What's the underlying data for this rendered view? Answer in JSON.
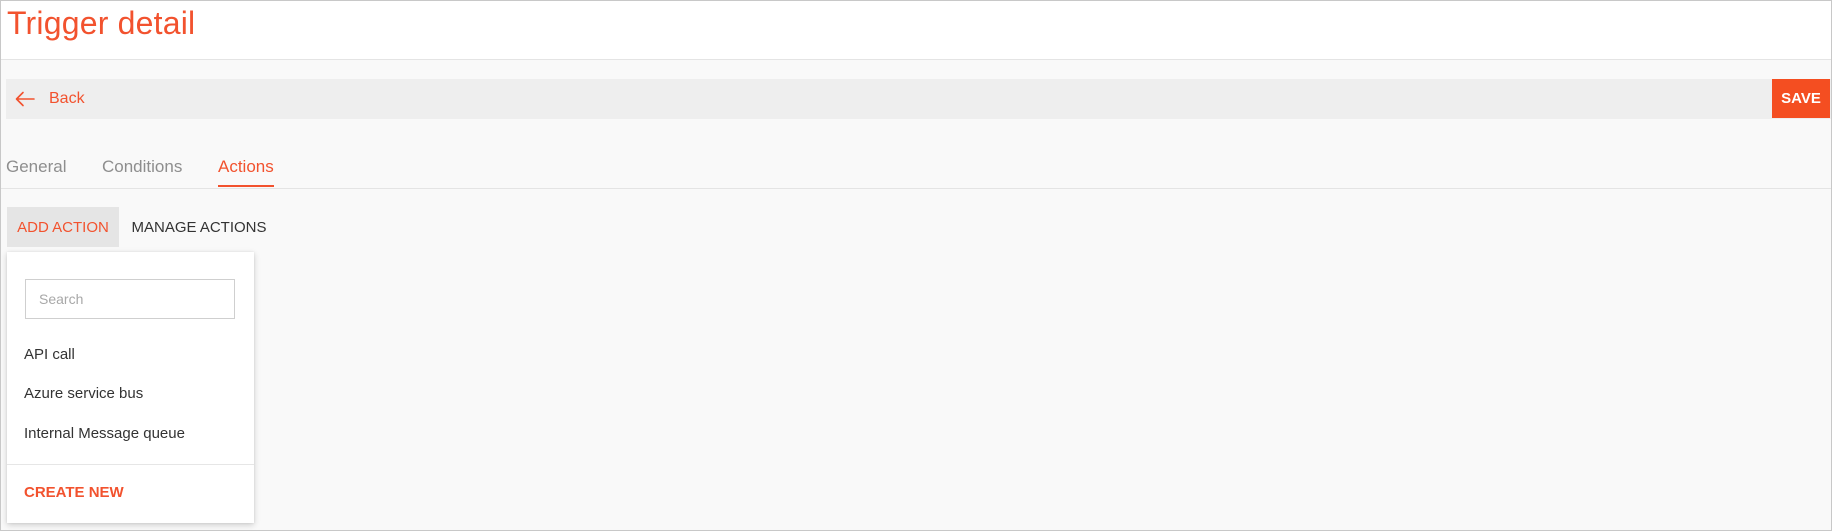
{
  "header": {
    "title": "Trigger detail"
  },
  "toolbar": {
    "back_label": "Back",
    "back_icon": "arrow-left-icon",
    "save_label": "SAVE"
  },
  "tabs": [
    {
      "label": "General",
      "active": false
    },
    {
      "label": "Conditions",
      "active": false
    },
    {
      "label": "Actions",
      "active": true
    }
  ],
  "actions_bar": {
    "add_action_label": "ADD ACTION",
    "manage_actions_label": "MANAGE ACTIONS"
  },
  "dropdown": {
    "search_placeholder": "Search",
    "search_value": "",
    "items": [
      {
        "label": "API call"
      },
      {
        "label": "Azure service bus"
      },
      {
        "label": "Internal Message queue"
      }
    ],
    "create_new_label": "CREATE NEW"
  },
  "colors": {
    "accent": "#f2522e",
    "save_button": "#f44e21",
    "toolbar_bg": "#eeeeee",
    "page_bg": "#f9f9f9"
  }
}
